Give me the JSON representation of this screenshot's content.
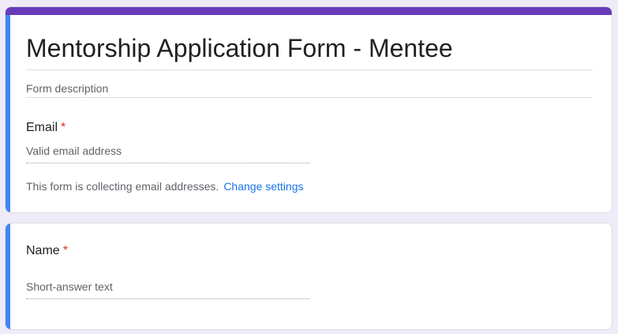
{
  "form": {
    "title": "Mentorship Application Form - Mentee",
    "description_placeholder": "Form description"
  },
  "email_question": {
    "label": "Email",
    "required_marker": "*",
    "placeholder": "Valid email address",
    "collect_note": "This form is collecting email addresses.",
    "change_settings_label": "Change settings"
  },
  "name_question": {
    "label": "Name",
    "required_marker": "*",
    "placeholder": "Short-answer text"
  },
  "colors": {
    "theme_purple": "#673ab7",
    "active_blue": "#4285f4",
    "link_blue": "#1a73e8",
    "required_red": "#d93025",
    "page_background": "#f0ebf8"
  }
}
